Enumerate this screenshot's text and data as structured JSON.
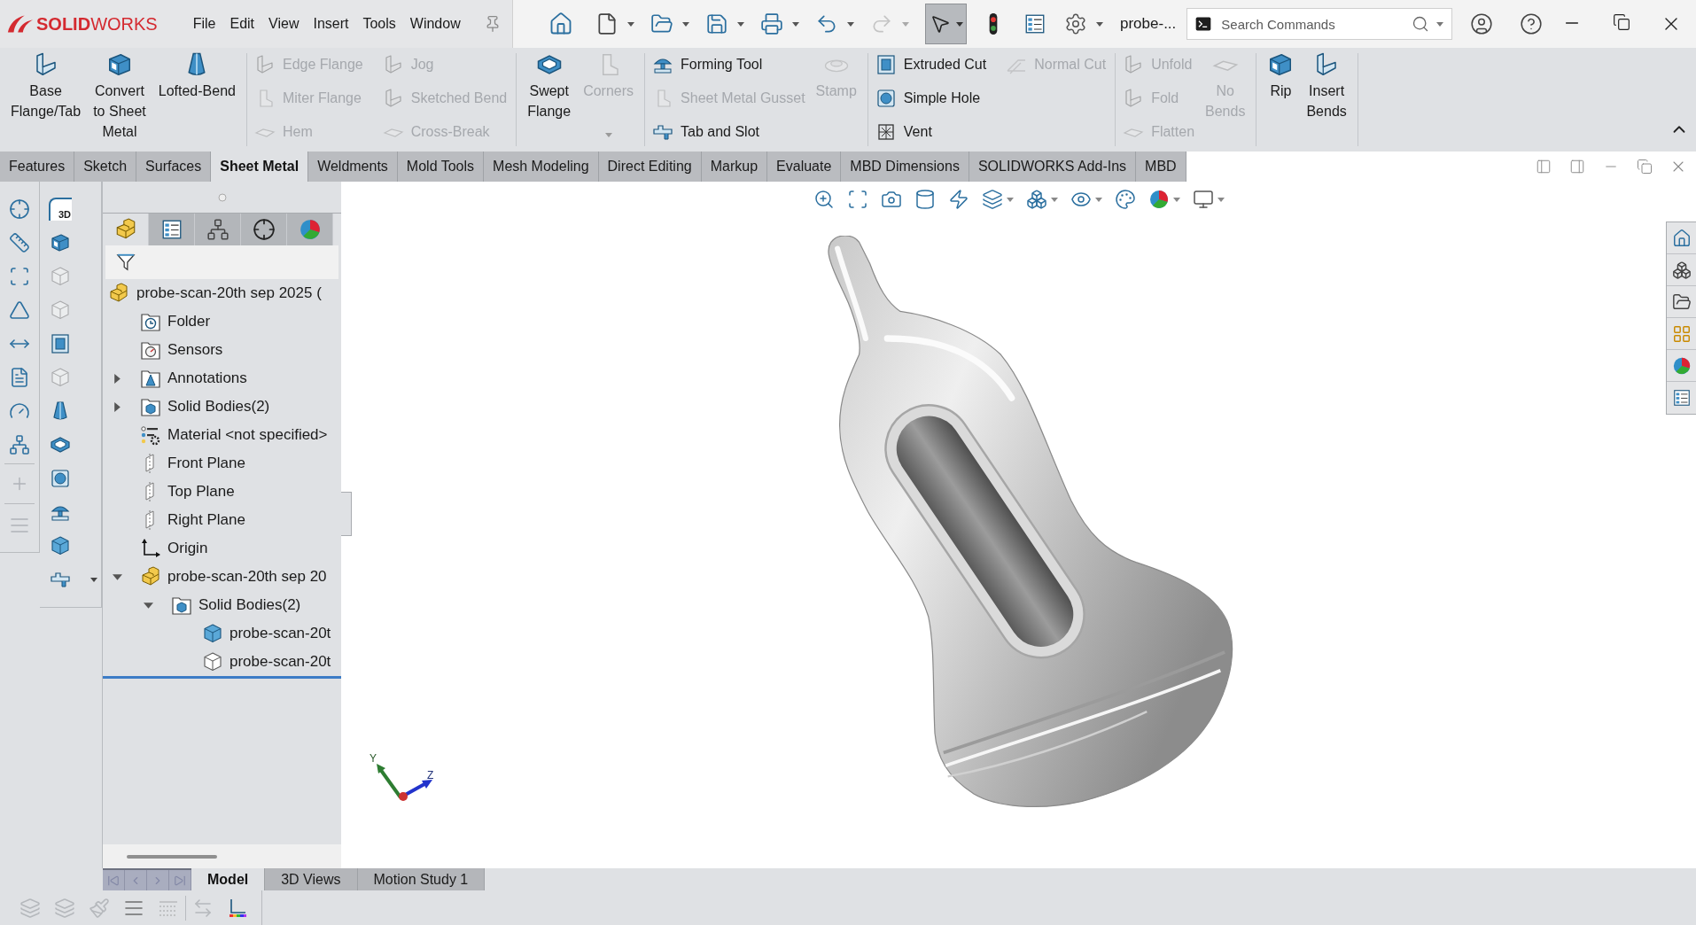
{
  "title_bar": {
    "logo": "**SOLID**WORKS",
    "menu": [
      "File",
      "Edit",
      "View",
      "Insert",
      "Tools",
      "Window"
    ],
    "redo_disabled": true,
    "select_tool_selected": true,
    "document": "probe-...",
    "search": {
      "placeholder": "Search Commands"
    }
  },
  "ribbon": {
    "groups": [
      {
        "items": [
          {
            "kind": "large",
            "label": "Base\nFlange/Tab",
            "disabled": false
          },
          {
            "kind": "large",
            "label": "Convert\nto Sheet\nMetal",
            "disabled": false
          },
          {
            "kind": "large",
            "label": "Lofted-Bend",
            "disabled": false
          }
        ]
      },
      {
        "items": [
          {
            "kind": "small",
            "label": "Edge Flange",
            "disabled": true
          },
          {
            "kind": "small",
            "label": "Miter Flange",
            "disabled": true
          },
          {
            "kind": "small",
            "label": "Hem",
            "disabled": true
          },
          {
            "kind": "small",
            "label": "Jog",
            "disabled": true
          },
          {
            "kind": "small",
            "label": "Sketched Bend",
            "disabled": true
          },
          {
            "kind": "small",
            "label": "Cross-Break",
            "disabled": true
          }
        ]
      },
      {
        "items": [
          {
            "kind": "large",
            "label": "Swept\nFlange",
            "disabled": false
          },
          {
            "kind": "dropdown",
            "label": "Corners",
            "disabled": true
          }
        ]
      },
      {
        "items": [
          {
            "kind": "small",
            "label": "Forming Tool",
            "disabled": false
          },
          {
            "kind": "small",
            "label": "Sheet Metal Gusset",
            "disabled": true
          },
          {
            "kind": "small",
            "label": "Tab and Slot",
            "disabled": false
          },
          {
            "kind": "large",
            "label": "Stamp",
            "disabled": true
          }
        ]
      },
      {
        "items": [
          {
            "kind": "small",
            "label": "Extruded Cut",
            "disabled": false
          },
          {
            "kind": "small",
            "label": "Simple Hole",
            "disabled": false
          },
          {
            "kind": "small",
            "label": "Vent",
            "disabled": false
          },
          {
            "kind": "small",
            "label": "Normal Cut",
            "disabled": true
          }
        ]
      },
      {
        "items": [
          {
            "kind": "small",
            "label": "Unfold",
            "disabled": true
          },
          {
            "kind": "small",
            "label": "Fold",
            "disabled": true
          },
          {
            "kind": "small",
            "label": "Flatten",
            "disabled": true
          },
          {
            "kind": "large",
            "label": "No\nBends",
            "disabled": true
          }
        ]
      },
      {
        "items": [
          {
            "kind": "large",
            "label": "Rip",
            "disabled": false
          },
          {
            "kind": "large",
            "label": "Insert\nBends",
            "disabled": false
          }
        ]
      }
    ]
  },
  "command_tabs": [
    {
      "label": "Features",
      "selected": false
    },
    {
      "label": "Sketch",
      "selected": false
    },
    {
      "label": "Surfaces",
      "selected": false
    },
    {
      "label": "Sheet Metal",
      "selected": true
    },
    {
      "label": "Weldments",
      "selected": false
    },
    {
      "label": "Mold Tools",
      "selected": false
    },
    {
      "label": "Mesh Modeling",
      "selected": false
    },
    {
      "label": "Direct Editing",
      "selected": false
    },
    {
      "label": "Markup",
      "selected": false
    },
    {
      "label": "Evaluate",
      "selected": false
    },
    {
      "label": "MBD Dimensions",
      "selected": false
    },
    {
      "label": "SOLIDWORKS Add-Ins",
      "selected": false
    },
    {
      "label": "MBD",
      "selected": false
    }
  ],
  "left_toolbar": {
    "sketch_3d_label": "3D"
  },
  "feature_manager": {
    "tabs": [
      {
        "kind": "feature-tree",
        "selected": true
      },
      {
        "kind": "property",
        "selected": false
      },
      {
        "kind": "configuration",
        "selected": false
      },
      {
        "kind": "dimxpert",
        "selected": false
      },
      {
        "kind": "display",
        "selected": false
      }
    ],
    "tree": {
      "kind": "part",
      "label": "probe-scan-20th sep 2025 (",
      "children": [
        {
          "kind": "history-folder",
          "label": "Folder"
        },
        {
          "kind": "sensors",
          "label": "Sensors"
        },
        {
          "kind": "annotations",
          "label": "Annotations",
          "expanded": false
        },
        {
          "kind": "solid-bodies",
          "label": "Solid Bodies(2)",
          "expanded": false
        },
        {
          "kind": "material",
          "label": "Material <not specified>"
        },
        {
          "kind": "plane",
          "label": "Front Plane"
        },
        {
          "kind": "plane",
          "label": "Top Plane"
        },
        {
          "kind": "plane",
          "label": "Right Plane"
        },
        {
          "kind": "origin",
          "label": "Origin"
        },
        {
          "kind": "part",
          "label": "probe-scan-20th sep 20",
          "expanded": true,
          "children": [
            {
              "kind": "solid-bodies",
              "label": "Solid Bodies(2)",
              "expanded": true,
              "children": [
                {
                  "kind": "body",
                  "label": "probe-scan-20t",
                  "hidden": false
                },
                {
                  "kind": "body",
                  "label": "probe-scan-20t",
                  "hidden": true
                }
              ]
            }
          ]
        }
      ]
    }
  },
  "viewport": {
    "triad_labels": [
      "Y",
      "Z"
    ]
  },
  "bottom_tabs": [
    {
      "label": "Model",
      "selected": true
    },
    {
      "label": "3D Views",
      "selected": false
    },
    {
      "label": "Motion Study 1",
      "selected": false
    }
  ]
}
